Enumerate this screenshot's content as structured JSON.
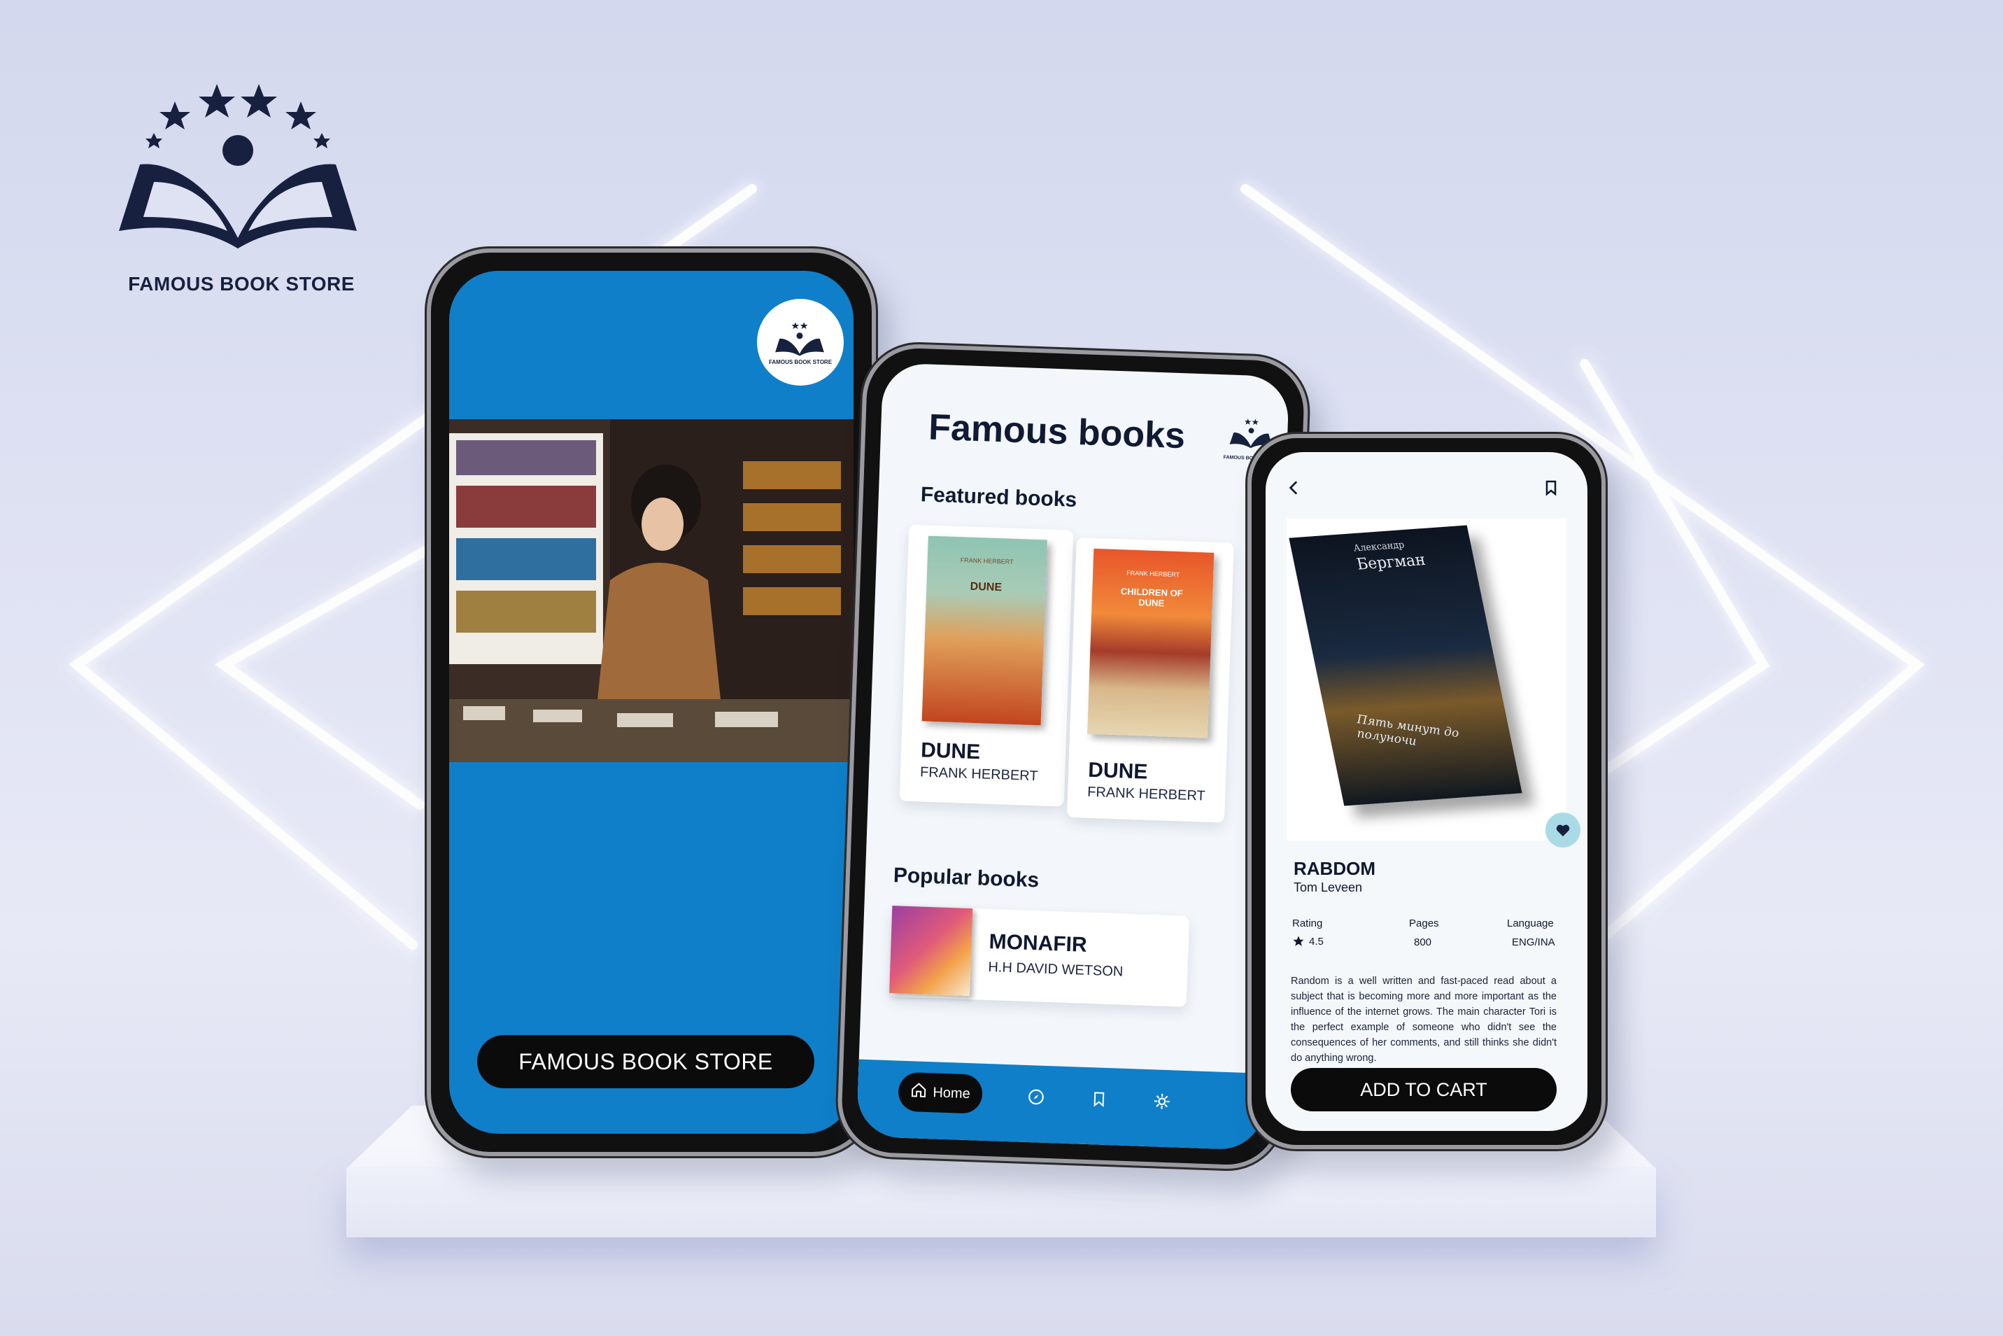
{
  "brand": {
    "name": "FAMOUS BOOK STORE",
    "logo_icon": "open-book-stars-icon",
    "color": "#17213f"
  },
  "phone_splash": {
    "logo_text": "FAMOUS BOOK STORE",
    "button_label": "FAMOUS BOOK STORE",
    "accent": "#0f7fc9"
  },
  "phone_home": {
    "title": "Famous books",
    "logo_text": "FAMOUS BOOK STORE",
    "featured_heading": "Featured books",
    "featured": [
      {
        "title": "DUNE",
        "author": "FRANK HERBERT",
        "cover_title": "DUNE",
        "cover_author": "FRANK HERBERT"
      },
      {
        "title": "DUNE",
        "author": "FRANK HERBERT",
        "cover_title": "CHILDREN OF DUNE",
        "cover_author": "FRANK HERBERT"
      }
    ],
    "popular_heading": "Popular books",
    "popular": [
      {
        "title": "MONAFIR",
        "author": "H.H DAVID WETSON"
      }
    ],
    "nav": {
      "home_label": "Home",
      "icons": [
        "home-icon",
        "compass-icon",
        "bookmark-icon",
        "settings-icon"
      ]
    }
  },
  "phone_detail": {
    "cover_author": "Александр",
    "cover_title": "Бергман",
    "cover_subtitle": "Пять минут до полуночи",
    "title": "RABDOM",
    "author": "Tom Leveen",
    "stats": [
      {
        "label": "Rating",
        "value": "4.5"
      },
      {
        "label": "Pages",
        "value": "800"
      },
      {
        "label": "Language",
        "value": "ENG/INA"
      }
    ],
    "description": "Random is a well written and fast-paced read about a subject that is becoming more and more important as the influence of the internet grows. The main character Tori is the perfect example of someone who didn't see the consequences of her comments, and still thinks she didn't do anything wrong.",
    "button_label": "ADD TO CART"
  }
}
